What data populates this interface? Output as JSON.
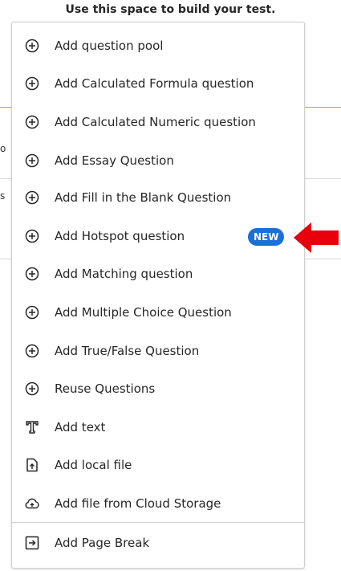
{
  "header": {
    "text": "Use this space to build your test."
  },
  "background": {
    "frag1": "o",
    "frag2": "s"
  },
  "menu": {
    "items": [
      {
        "label": "Add question pool",
        "icon": "plus-circle-icon"
      },
      {
        "label": "Add Calculated Formula question",
        "icon": "plus-circle-icon"
      },
      {
        "label": "Add Calculated Numeric question",
        "icon": "plus-circle-icon"
      },
      {
        "label": "Add Essay Question",
        "icon": "plus-circle-icon"
      },
      {
        "label": "Add Fill in the Blank Question",
        "icon": "plus-circle-icon"
      },
      {
        "label": "Add Hotspot question",
        "icon": "plus-circle-icon",
        "badge": "NEW"
      },
      {
        "label": "Add Matching question",
        "icon": "plus-circle-icon"
      },
      {
        "label": "Add Multiple Choice Question",
        "icon": "plus-circle-icon"
      },
      {
        "label": "Add True/False Question",
        "icon": "plus-circle-icon"
      },
      {
        "label": "Reuse Questions",
        "icon": "plus-circle-icon"
      },
      {
        "label": "Add text",
        "icon": "text-icon"
      },
      {
        "label": "Add local file",
        "icon": "file-upload-icon"
      },
      {
        "label": "Add file from Cloud Storage",
        "icon": "cloud-upload-icon"
      },
      {
        "label": "Add Page Break",
        "icon": "page-break-icon"
      }
    ]
  },
  "colors": {
    "badge": "#1a6fd8",
    "arrow": "#e8000b",
    "accent_line": "#b58ad6"
  }
}
